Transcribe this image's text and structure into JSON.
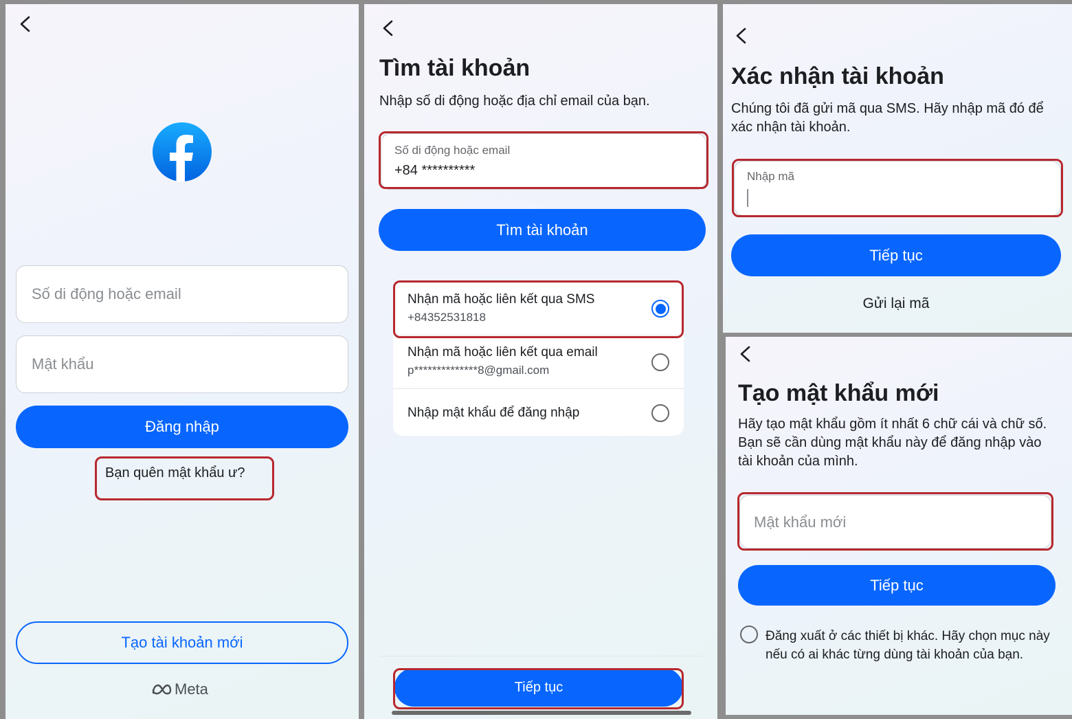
{
  "colors": {
    "primary": "#0866ff",
    "highlight": "#b7282e"
  },
  "screen1": {
    "back_icon": "chevron-left-icon",
    "logo_icon": "facebook-logo-icon",
    "phone_placeholder": "Số di động hoặc email",
    "password_placeholder": "Mật khẩu",
    "login_button": "Đăng nhập",
    "forgot_password": "Bạn quên mật khẩu ư?",
    "create_account": "Tạo tài khoản mới",
    "meta_icon": "meta-infinity-icon",
    "meta_label": "Meta"
  },
  "screen2": {
    "back_icon": "chevron-left-icon",
    "title": "Tìm tài khoản",
    "description": "Nhập số di động hoặc địa chỉ email của bạn.",
    "field_label": "Số di động hoặc email",
    "field_value": "+84 **********",
    "find_button": "Tìm tài khoản",
    "options": [
      {
        "title": "Nhận mã hoặc liên kết qua SMS",
        "subtitle": "+84352531818",
        "selected": true
      },
      {
        "title": "Nhận mã hoặc liên kết qua email",
        "subtitle": "p**************8@gmail.com",
        "selected": false
      },
      {
        "title": "Nhập mật khẩu để đăng nhập",
        "subtitle": "",
        "selected": false
      }
    ],
    "continue_button": "Tiếp tục"
  },
  "screen3": {
    "back_icon": "chevron-left-icon",
    "title": "Xác nhận tài khoản",
    "description": "Chúng tôi đã gửi mã qua SMS. Hãy nhập mã đó để xác nhận tài khoản.",
    "code_label": "Nhập mã",
    "continue_button": "Tiếp tục",
    "resend": "Gửi lại mã"
  },
  "screen4": {
    "back_icon": "chevron-left-icon",
    "title": "Tạo mật khẩu mới",
    "description": "Hãy tạo mật khẩu gồm ít nhất 6 chữ cái và chữ số. Bạn sẽ cần dùng mật khẩu này để đăng nhập vào tài khoản của mình.",
    "new_password_placeholder": "Mật khẩu mới",
    "continue_button": "Tiếp tục",
    "logout_option": "Đăng xuất ở các thiết bị khác. Hãy chọn mục này nếu có ai khác từng dùng tài khoản của bạn."
  }
}
